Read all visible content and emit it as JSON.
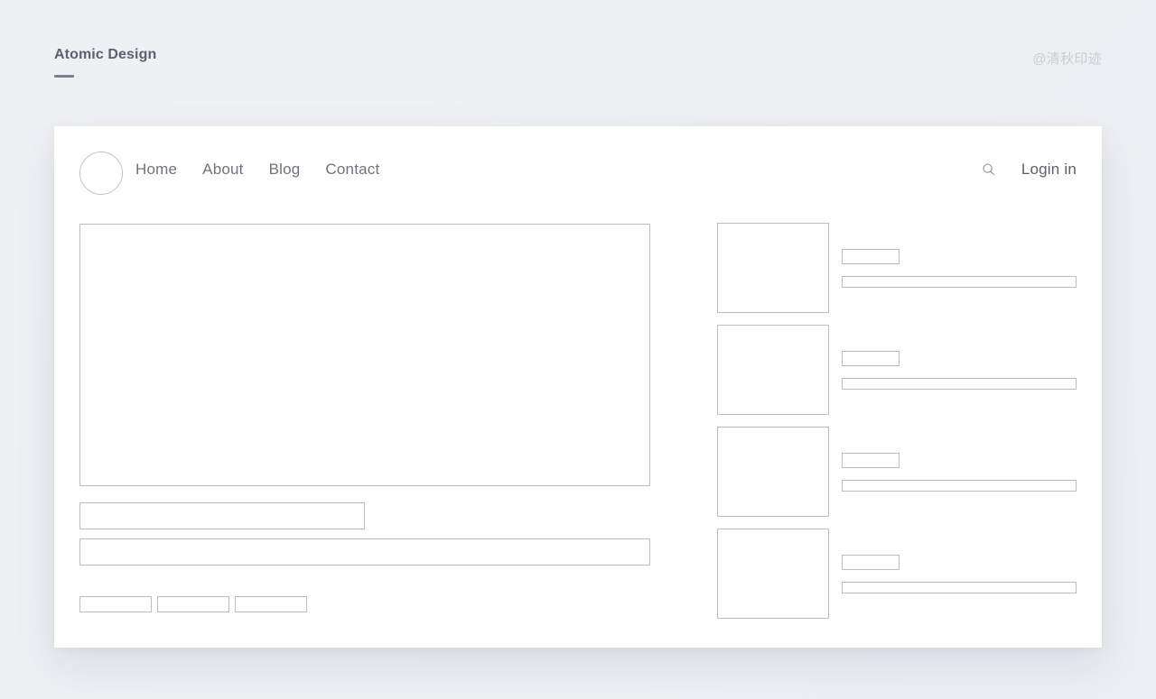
{
  "page": {
    "title": "Atomic Design",
    "watermark": "@清秋印迹",
    "accent_color": "#7b818c",
    "background_color": "#eef0f4",
    "card_background": "#ffffff",
    "wireframe_border_color": "#b9bdc5",
    "text_color": "#6e737d"
  },
  "navbar": {
    "logo": "logo-circle-placeholder",
    "links": [
      {
        "label": "Home"
      },
      {
        "label": "About"
      },
      {
        "label": "Blog"
      },
      {
        "label": "Contact"
      }
    ],
    "search_icon": "search-icon",
    "login_label": "Login in"
  },
  "main": {
    "hero": {
      "placeholder": ""
    },
    "bars": [
      {
        "placeholder": ""
      },
      {
        "placeholder": ""
      }
    ],
    "buttons": [
      {
        "placeholder": ""
      },
      {
        "placeholder": ""
      },
      {
        "placeholder": ""
      }
    ]
  },
  "list": {
    "items": [
      {
        "thumbnail": "",
        "title_placeholder": "",
        "description_placeholder": ""
      },
      {
        "thumbnail": "",
        "title_placeholder": "",
        "description_placeholder": ""
      },
      {
        "thumbnail": "",
        "title_placeholder": "",
        "description_placeholder": ""
      },
      {
        "thumbnail": "",
        "title_placeholder": "",
        "description_placeholder": ""
      }
    ]
  }
}
